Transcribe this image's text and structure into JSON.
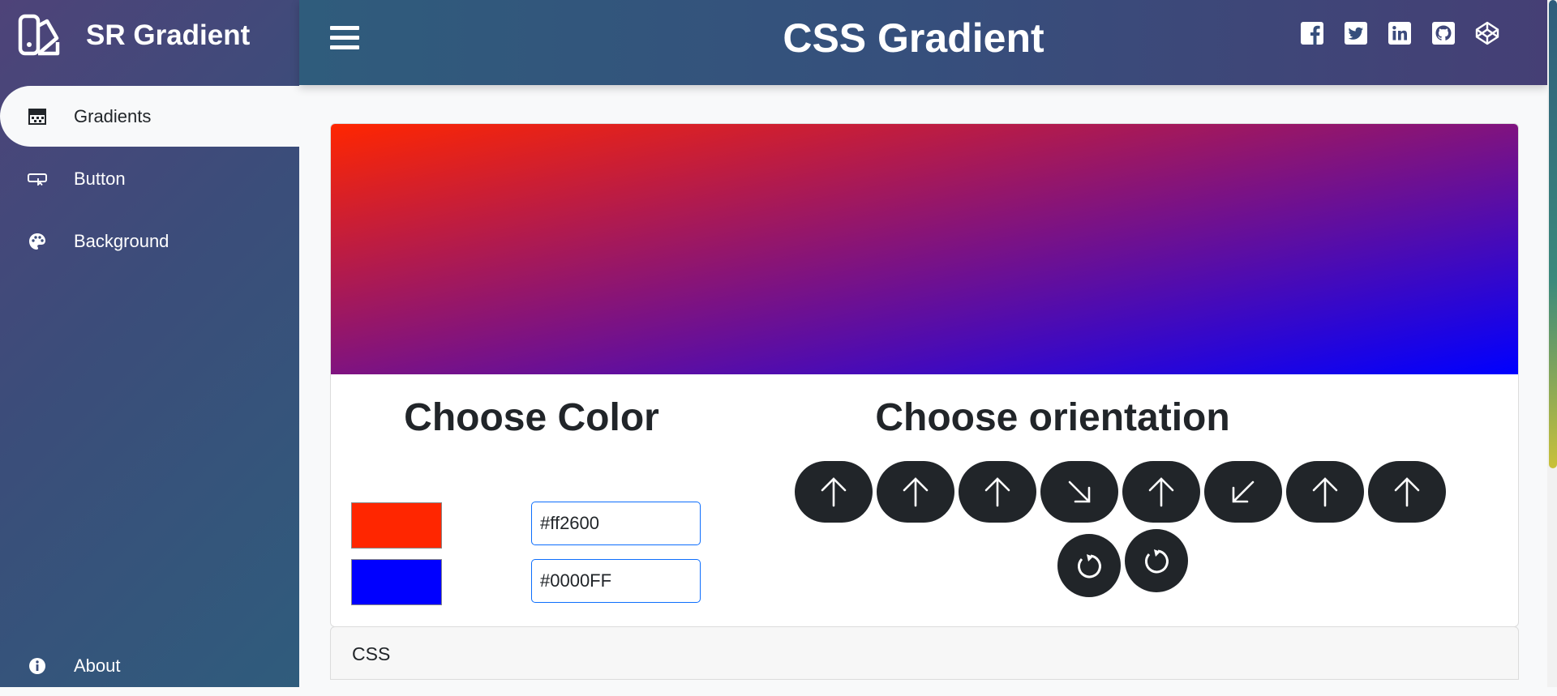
{
  "brand": {
    "name": "SR Gradient",
    "logo_icon": "swatchbook-icon"
  },
  "sidebar": {
    "items": [
      {
        "label": "Gradients",
        "icon": "gradient-icon",
        "active": true
      },
      {
        "label": "Button",
        "icon": "button-icon",
        "active": false
      },
      {
        "label": "Background",
        "icon": "palette-icon",
        "active": false
      },
      {
        "label": "About",
        "icon": "info-icon",
        "active": false
      }
    ]
  },
  "header": {
    "title": "CSS Gradient",
    "menu_icon": "hamburger-icon",
    "socials": [
      "facebook-icon",
      "twitter-icon",
      "linkedin-icon",
      "github-icon",
      "codepen-icon"
    ]
  },
  "gradient": {
    "color1": "#ff2600",
    "color2": "#0000FF",
    "direction": "to bottom right"
  },
  "main": {
    "choose_color_heading": "Choose Color",
    "choose_orientation_heading": "Choose orientation",
    "color_inputs": [
      "#ff2600",
      "#0000FF"
    ],
    "orientation_buttons": [
      "arrow-up-icon",
      "arrow-up-icon",
      "arrow-up-icon",
      "arrow-down-right-icon",
      "arrow-up-icon",
      "arrow-down-left-icon",
      "arrow-up-icon",
      "arrow-up-icon"
    ],
    "rotation_buttons": [
      "rotate-icon",
      "rotate-icon"
    ],
    "css_section_label": "CSS"
  },
  "colors": {
    "sidebar_start": "#4e4379",
    "sidebar_end": "#2f5c7c",
    "button_dark": "#212529",
    "input_border": "#0d6efd"
  }
}
